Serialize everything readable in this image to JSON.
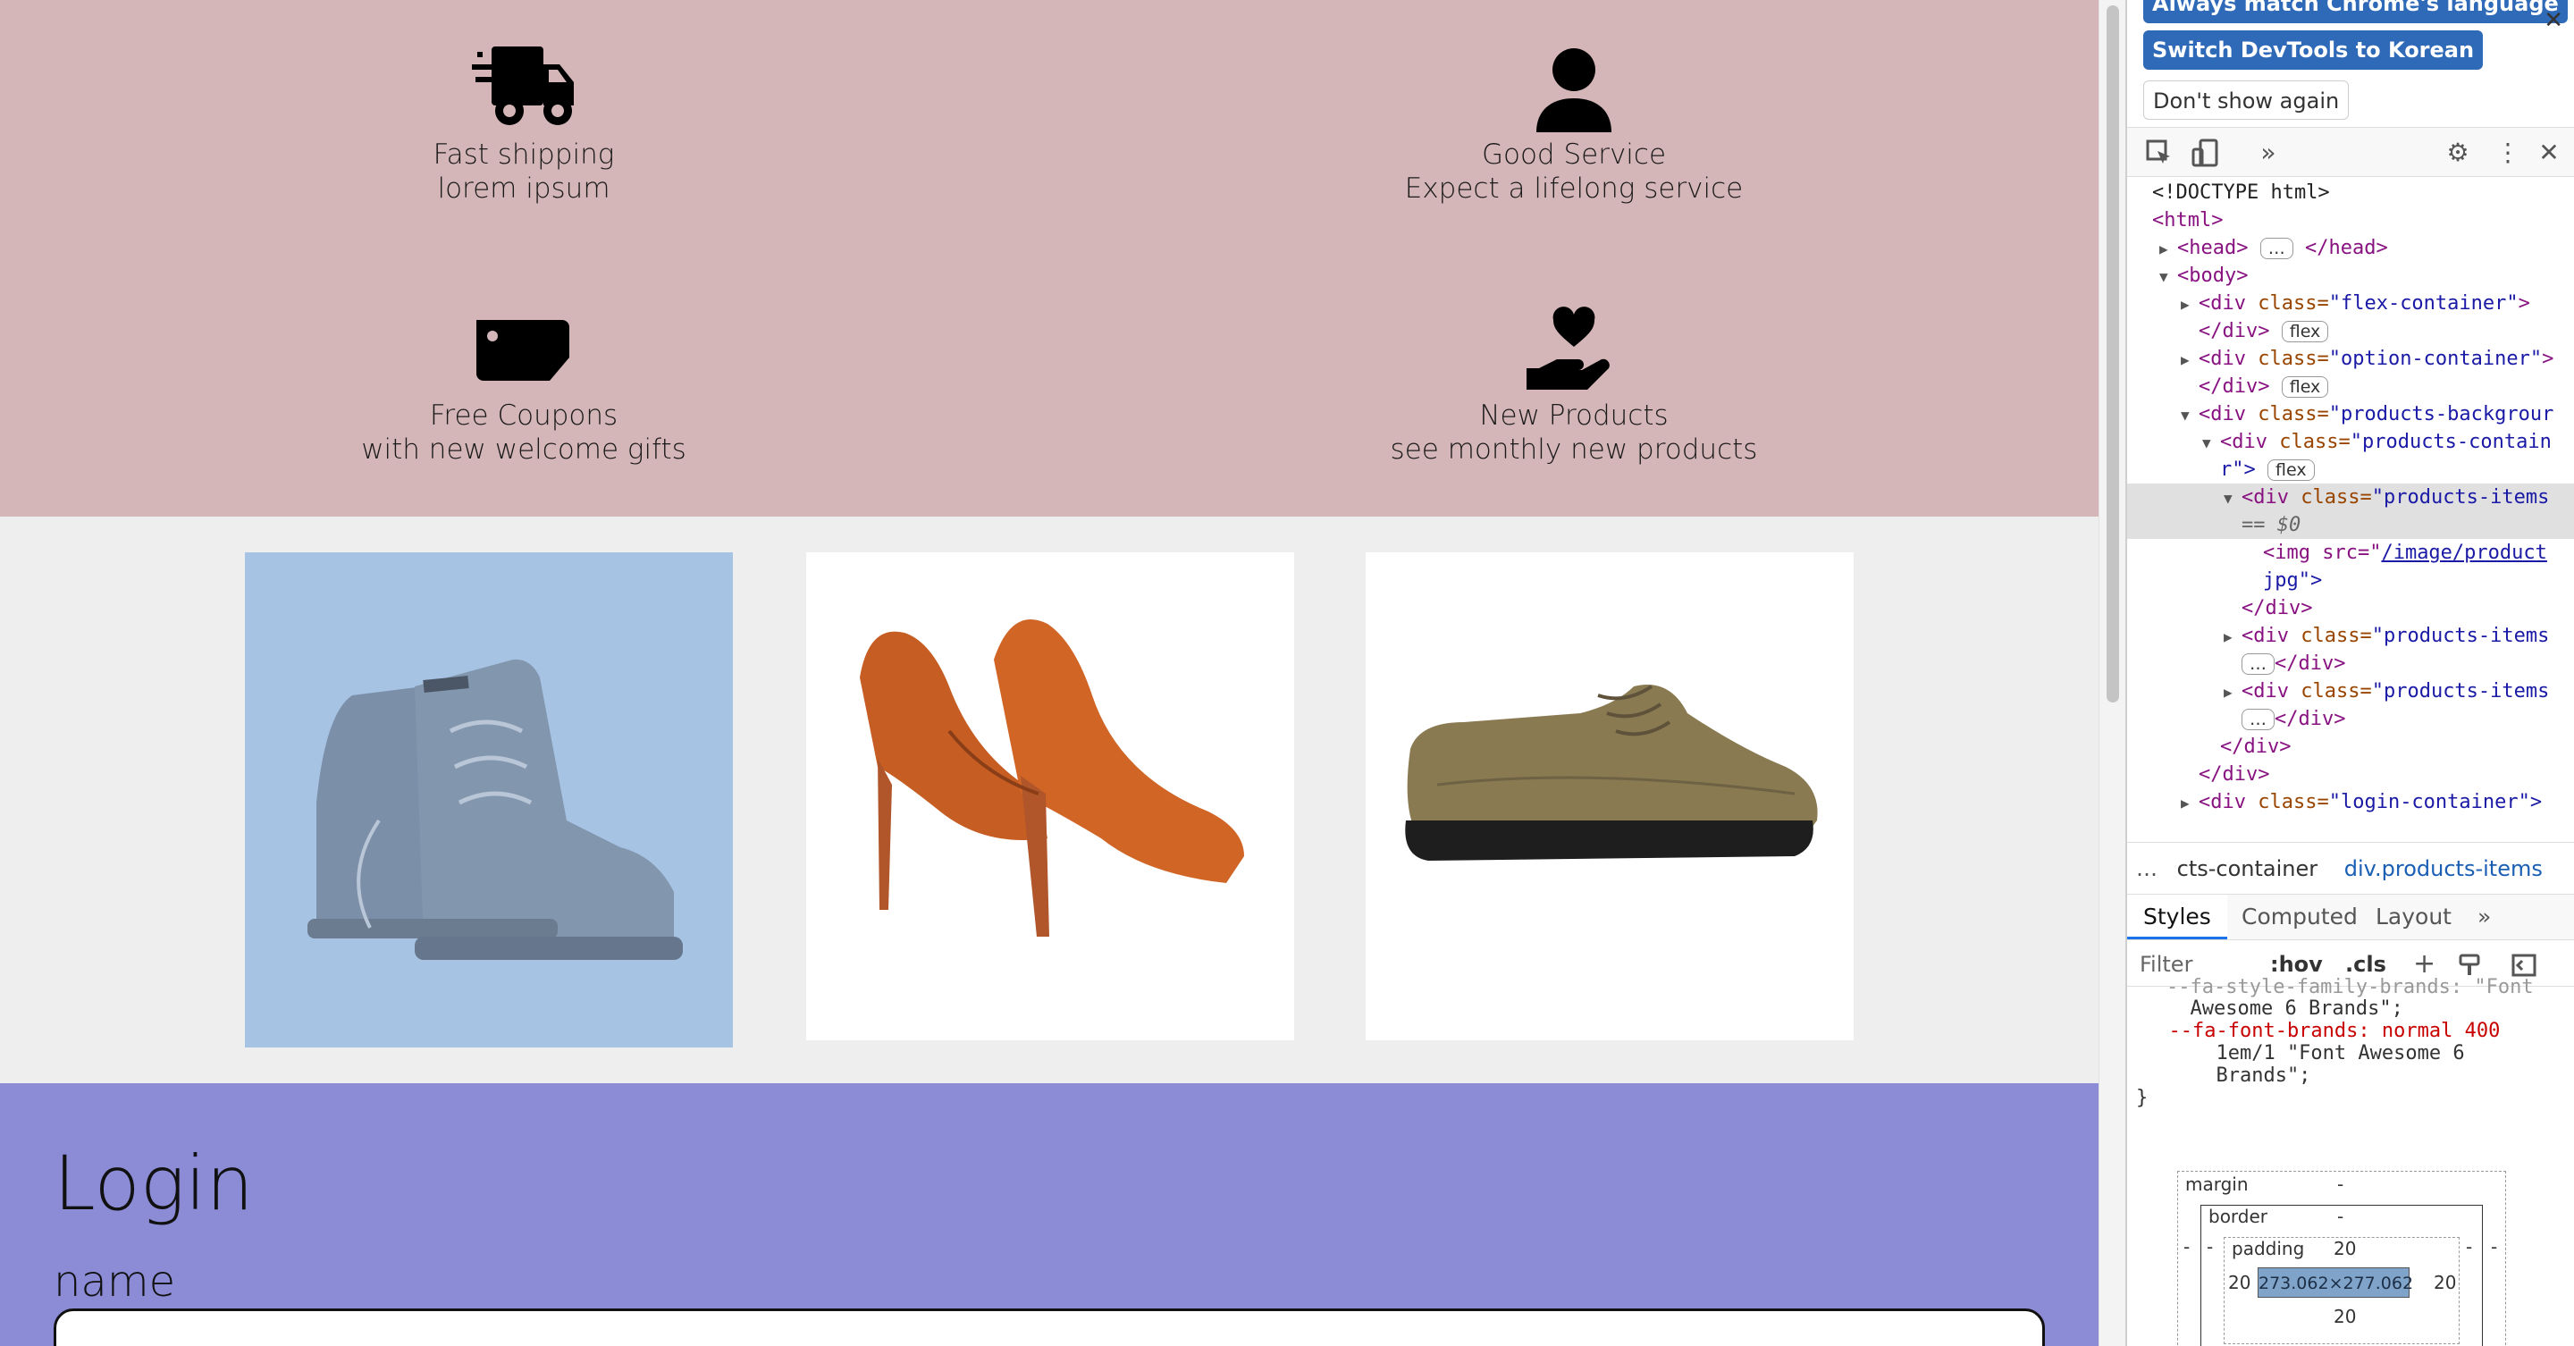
{
  "features": [
    {
      "icon": "truck-fast-icon",
      "line1": "Fast shipping",
      "line2": "lorem ipsum"
    },
    {
      "icon": "user-icon",
      "line1": "Good Service",
      "line2": "Expect a lifelong service"
    },
    {
      "icon": "ticket-icon",
      "line1": "Free Coupons",
      "line2": "with new welcome gifts"
    },
    {
      "icon": "hand-holding-heart-icon",
      "line1": "New Products",
      "line2": "see monthly new products"
    }
  ],
  "products": [
    {
      "name": "work-boots-image",
      "bg": "#a6c3e4"
    },
    {
      "name": "orange-heels-image",
      "bg": "#ffffff"
    },
    {
      "name": "leather-shoe-image",
      "bg": "#ffffff"
    }
  ],
  "login": {
    "title": "Login",
    "name_label": "name",
    "name_value": ""
  },
  "devtools": {
    "banner": {
      "match_language": "Always match Chrome's language",
      "switch_language": "Switch DevTools to Korean",
      "dont_show": "Don't show again"
    },
    "dom": {
      "doctype": "<!DOCTYPE html>",
      "html_open": "<html>",
      "head": "<head>",
      "head_close": "</head>",
      "body_open": "<body>",
      "div_open": "<div",
      "div_close": "</div>",
      "class_attr": "class=",
      "flex_container": "\"flex-container\"",
      "option_container": "\"option-container\"",
      "products_background": "\"products-backgrour",
      "products_container_a": "\"products-contain",
      "products_container_b": "r\">",
      "products_items": "\"products-items",
      "login_container": "\"login-container\">",
      "eq_dollar0": "== $0",
      "img_src": "<img src=\"",
      "img_path": "/image/product",
      "img_tail": "jpg\">",
      "flex_badge": "flex",
      "ellipsis": "…",
      "gt": ">"
    },
    "crumbs": {
      "first": "cts-container",
      "second": "div.products-items"
    },
    "tabs": [
      "Styles",
      "Computed",
      "Layout"
    ],
    "filter": {
      "placeholder": "Filter",
      "hov": ":hov",
      "cls": ".cls"
    },
    "styles_lines": [
      "  Awesome 6 Brands\";",
      "  --fa-font-brands: normal 400",
      "      1em/1 \"Font Awesome 6",
      "      Brands\";",
      "}"
    ],
    "styles_cut": "--fa-style-family-brands: \"Font",
    "boxmodel": {
      "margin": "margin",
      "border": "border",
      "padding": "padding",
      "dash": "-",
      "padding_value": "20",
      "content": "273.062×277.062"
    }
  }
}
